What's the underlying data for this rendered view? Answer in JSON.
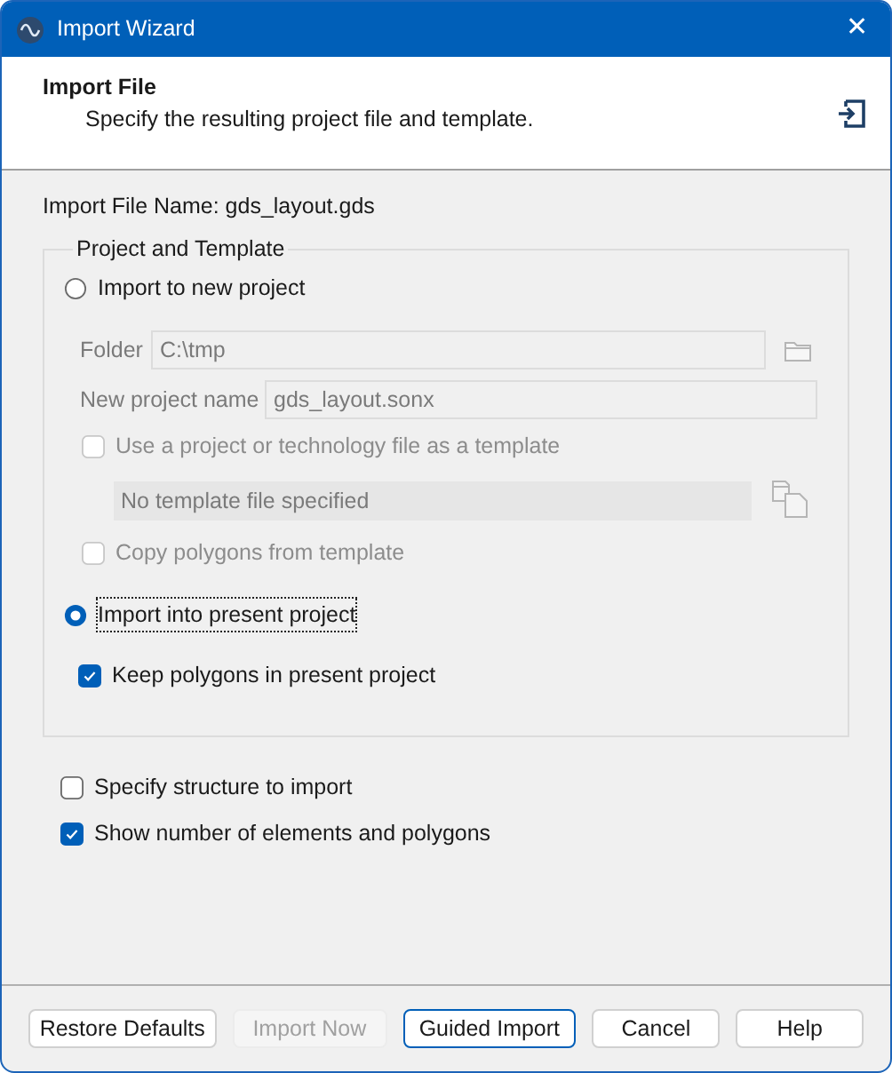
{
  "window": {
    "title": "Import Wizard",
    "close": "✕"
  },
  "header": {
    "title": "Import File",
    "subtitle": "Specify the resulting project file and template."
  },
  "import_file_name": "Import File Name: gds_layout.gds",
  "group": {
    "title": "Project and Template",
    "new_project": {
      "label": "Import to new project",
      "selected": false
    },
    "folder": {
      "label": "Folder",
      "value": "C:\\tmp",
      "disabled": true
    },
    "project_name": {
      "label": "New project name",
      "value": "gds_layout.sonx",
      "disabled": true
    },
    "use_template": {
      "label": "Use a project or technology file as a template",
      "checked": false,
      "disabled": true
    },
    "template_file": {
      "value": "No template file specified",
      "disabled": true
    },
    "copy_polygons": {
      "label": "Copy polygons from template",
      "checked": false,
      "disabled": true
    },
    "present_project": {
      "label": "Import into present project",
      "selected": true,
      "focused": true
    },
    "keep_polygons": {
      "label": "Keep polygons in present project",
      "checked": true,
      "disabled": false
    }
  },
  "options": [
    {
      "label": "Specify structure to import",
      "checked": false
    },
    {
      "label": "Show number of elements and polygons",
      "checked": true
    }
  ],
  "buttons": [
    {
      "label": "Restore Defaults",
      "disabled": false,
      "default": false
    },
    {
      "label": "Import Now",
      "disabled": true,
      "default": false
    },
    {
      "label": "Guided Import",
      "disabled": false,
      "default": true
    },
    {
      "label": "Cancel",
      "disabled": false,
      "default": false
    },
    {
      "label": "Help",
      "disabled": false,
      "default": false
    }
  ]
}
